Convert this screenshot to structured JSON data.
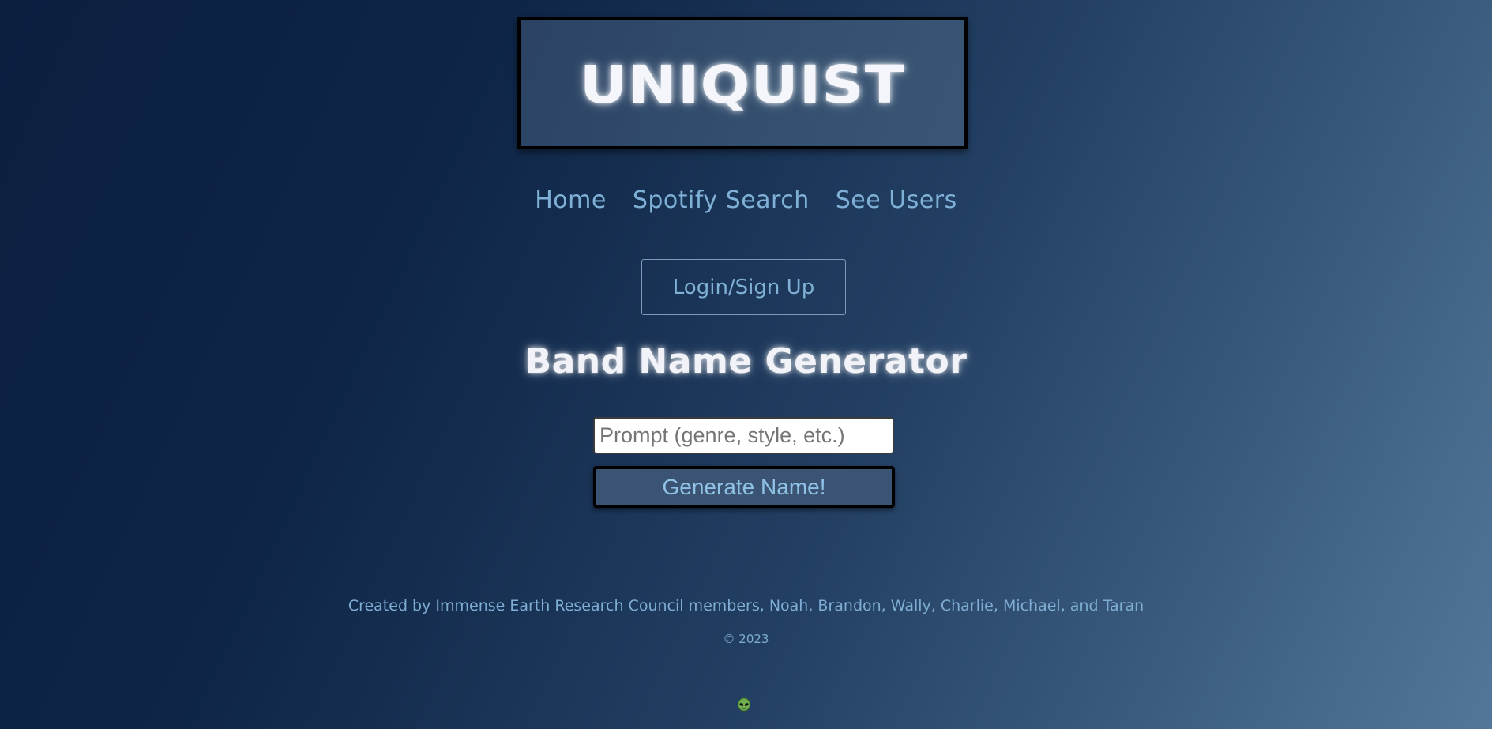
{
  "header": {
    "logo_text": "UNIQUIST"
  },
  "nav": {
    "items": [
      {
        "label": "Home"
      },
      {
        "label": "Spotify Search"
      },
      {
        "label": "See Users"
      }
    ]
  },
  "auth": {
    "login_label": "Login/Sign Up"
  },
  "generator": {
    "title": "Band Name Generator",
    "prompt_value": "",
    "prompt_placeholder": "Prompt (genre, style, etc.)",
    "button_label": "Generate Name!"
  },
  "footer": {
    "credit": "Created by Immense Earth Research Council members, Noah, Brandon, Wally, Charlie, Michael, and Taran",
    "copyright": "© 2023",
    "icon": "alien-icon"
  },
  "colors": {
    "link": "#7fb0d6",
    "glow_text": "#f1f3f8",
    "button_bg": "#3b5474"
  }
}
